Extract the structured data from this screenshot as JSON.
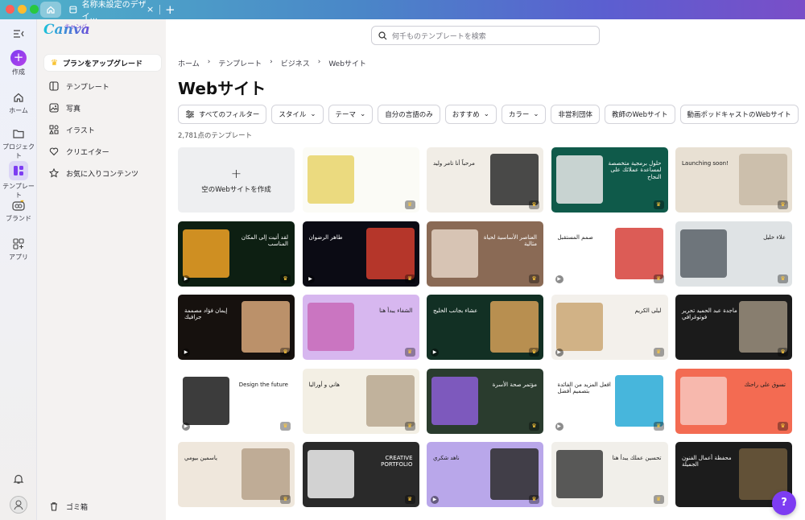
{
  "tabs": {
    "doc_title": "名称未設定のデザイ..."
  },
  "rail": {
    "create": "作成",
    "home": "ホーム",
    "projects": "プロジェクト",
    "templates": "テンプレート",
    "brand": "ブランド",
    "apps": "アプリ"
  },
  "sidebar": {
    "logo": "Canva",
    "logo_kana": "キャンバ",
    "upgrade": "プランをアップグレード",
    "items": [
      {
        "label": "テンプレート",
        "icon": "template-icon"
      },
      {
        "label": "写真",
        "icon": "photo-icon"
      },
      {
        "label": "イラスト",
        "icon": "shapes-icon"
      },
      {
        "label": "クリエイター",
        "icon": "heart-badge-icon"
      },
      {
        "label": "お気に入りコンテンツ",
        "icon": "star-icon"
      }
    ],
    "trash": "ゴミ箱"
  },
  "search": {
    "placeholder": "何千ものテンプレートを検索"
  },
  "breadcrumb": [
    "ホーム",
    "テンプレート",
    "ビジネス",
    "Webサイト"
  ],
  "page_title": "Webサイト",
  "filters": {
    "all": "すべてのフィルター",
    "style": "スタイル",
    "theme": "テーマ",
    "own_language": "自分の言語のみ",
    "recommended": "おすすめ",
    "color": "カラー",
    "nonprofit": "非営利団体",
    "teacher_web": "教師のWebサイト",
    "podcast_web": "動画ポッドキャストのWebサイト"
  },
  "count": "2,781点のテンプレート",
  "empty_card": "空のWebサイトを作成",
  "help": "?",
  "cards": [
    {
      "row": 0,
      "col": 1,
      "bg": "#fbfbf6",
      "accent": "#e8d36a",
      "text": ""
    },
    {
      "row": 0,
      "col": 2,
      "bg": "#f1ede6",
      "accent": "#2b2b2b",
      "text": "مرحباً أنا تامر وليد"
    },
    {
      "row": 0,
      "col": 3,
      "bg": "#0f5a4a",
      "accent": "#e9e9e9",
      "text": "حلول برمجية متخصصة لمساعدة عملائك على النجاح"
    },
    {
      "row": 0,
      "col": 4,
      "bg": "#e8e0d3",
      "accent": "#c7b9a5",
      "text": "Launching soon!"
    },
    {
      "row": 1,
      "col": 0,
      "bg": "#0d1f12",
      "accent": "#f2a326",
      "text": "لقد أتيت إلى المكان المناسب"
    },
    {
      "row": 1,
      "col": 1,
      "bg": "#0b0b14",
      "accent": "#d43e2e",
      "text": "طاهر الرضوان"
    },
    {
      "row": 1,
      "col": 2,
      "bg": "#8a6a55",
      "accent": "#e4d3c6",
      "text": "العناصر الأساسية لحياة مثالية"
    },
    {
      "row": 1,
      "col": 3,
      "bg": "#ffffff",
      "accent": "#d64038",
      "text": "صمم المستقبل"
    },
    {
      "row": 1,
      "col": 4,
      "bg": "#dfe3e5",
      "accent": "#5a6168",
      "text": "علاء خليل"
    },
    {
      "row": 2,
      "col": 0,
      "bg": "#16110e",
      "accent": "#d8a87a",
      "text": "إيمان فؤاد مصممة جرافيك"
    },
    {
      "row": 2,
      "col": 1,
      "bg": "#d7b7ef",
      "accent": "#c86ab8",
      "text": "الشفاء يبدأ هنا"
    },
    {
      "row": 2,
      "col": 2,
      "bg": "#123024",
      "accent": "#d6a058",
      "text": "عشاء بجانب الخليج"
    },
    {
      "row": 2,
      "col": 3,
      "bg": "#f3f0eb",
      "accent": "#caa774",
      "text": "ليلى الكريم"
    },
    {
      "row": 2,
      "col": 4,
      "bg": "#1b1b1b",
      "accent": "#9b8f7e",
      "text": "ماجدة عبد الحميد تحرير فوتوغرافي"
    },
    {
      "row": 3,
      "col": 0,
      "bg": "#ffffff",
      "accent": "#1a1a1a",
      "text": "Design the future"
    },
    {
      "row": 3,
      "col": 1,
      "bg": "#f3efe4",
      "accent": "#b7a78f",
      "text": "هاني و أوراليا"
    },
    {
      "row": 3,
      "col": 2,
      "bg": "#2a3c2e",
      "accent": "#8c5ed6",
      "text": "مؤتمر صحة الأسرة"
    },
    {
      "row": 3,
      "col": 3,
      "bg": "#ffffff",
      "accent": "#27a9d6",
      "text": "افعل المزيد من الفائدة بتصميم أفضل"
    },
    {
      "row": 3,
      "col": 4,
      "bg": "#f36b52",
      "accent": "#f7c6bd",
      "text": "تسوق على راحتك"
    },
    {
      "row": 4,
      "col": 0,
      "bg": "#efe7dc",
      "accent": "#b6a18a",
      "text": "ياسمين بيومي"
    },
    {
      "row": 4,
      "col": 1,
      "bg": "#2a2a2a",
      "accent": "#f0f0f0",
      "text": "CREATIVE PORTFOLIO"
    },
    {
      "row": 4,
      "col": 2,
      "bg": "#b9a7ea",
      "accent": "#2b2b2b",
      "text": "ناهد شكري"
    },
    {
      "row": 4,
      "col": 3,
      "bg": "#f1efea",
      "accent": "#3d3d3d",
      "text": "تحسين عملك يبدأ هنا"
    },
    {
      "row": 4,
      "col": 4,
      "bg": "#1c1c1c",
      "accent": "#6f5a3c",
      "text": "محفظة أعمال الفنون الجميلة"
    }
  ],
  "colors": {
    "brand_purple": "#7d3cf2",
    "panel_bg": "#f4f2f1",
    "card_empty": "#eeeff1"
  }
}
